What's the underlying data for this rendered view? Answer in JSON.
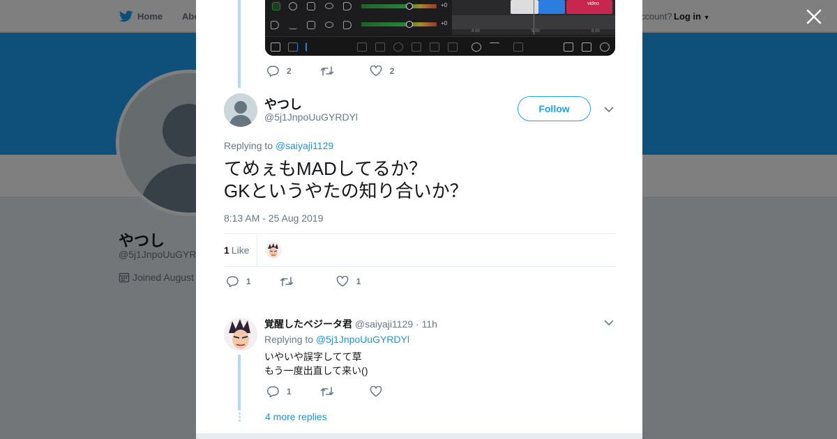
{
  "nav": {
    "home": "Home",
    "about": "Abo",
    "account_prompt": "ccount?",
    "login": "Log in"
  },
  "profile_bg": {
    "name": "やつし",
    "handle": "@5j1JnpoUuGYR",
    "joined": "Joined August"
  },
  "colors": {
    "accent": "#1da1f2",
    "link": "#1b95e0",
    "thread_line": "#b3d9f6",
    "muted": "#657786"
  },
  "prev_tweet": {
    "replies": "2",
    "retweets": "",
    "likes": "2"
  },
  "media": {
    "meter_labels": [
      "+0",
      "+0"
    ],
    "time_ticks": [
      "4.00",
      "5.00",
      "6.00"
    ],
    "clip_label": "video"
  },
  "main_tweet": {
    "name": "やつし",
    "handle": "@5j1JnpoUuGYRDYl",
    "follow": "Follow",
    "replying_prefix": "Replying to ",
    "replying_to": "@saiyaji1129",
    "text": "てめぇもMADしてるか？\nGKというやたの知り合いか？",
    "timestamp": "8:13 AM - 25 Aug 2019",
    "like_count": "1",
    "like_label": "Like",
    "replies": "1",
    "retweets": "",
    "likes": "1"
  },
  "reply": {
    "name": "覚醒したベジータ君",
    "handle": "@saiyaji1129",
    "time": "· 11h",
    "replying_prefix": "Replying to ",
    "replying_to": "@5j1JnpoUuGYRDYl",
    "text": "いやいや誤字してて草\nもう一度出直して来い()",
    "replies": "1",
    "retweets": "",
    "likes": ""
  },
  "more_replies": "4 more replies"
}
